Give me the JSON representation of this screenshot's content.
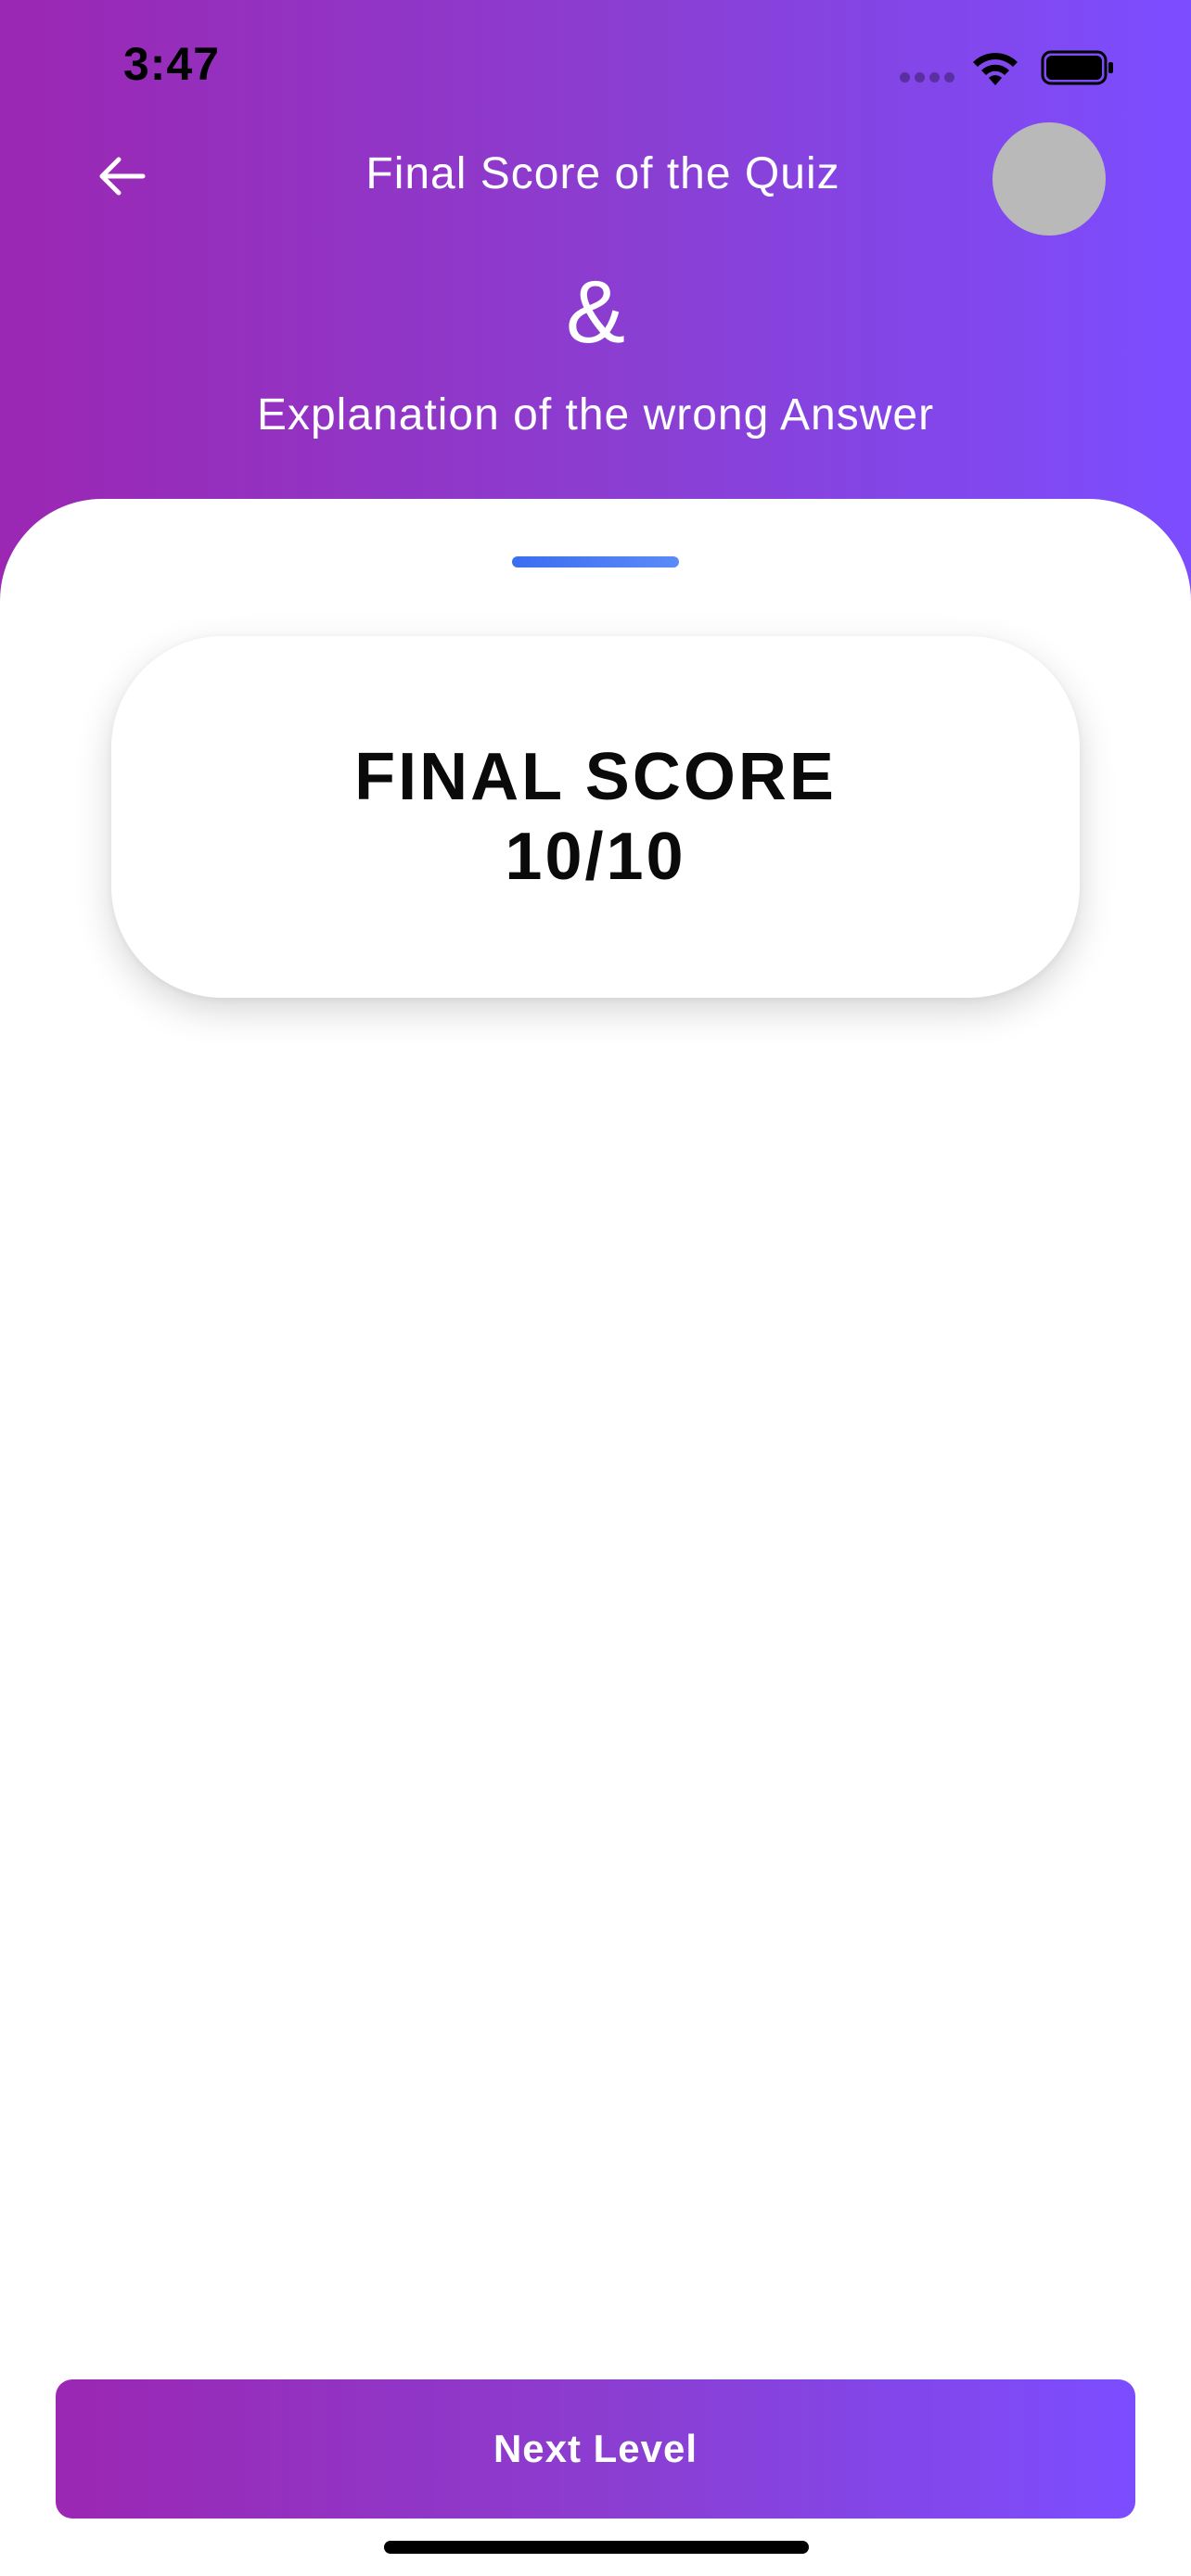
{
  "status_bar": {
    "time": "3:47",
    "icons": [
      "signal-icon",
      "wifi-icon",
      "battery-icon"
    ]
  },
  "header": {
    "back_icon": "arrow-left-icon",
    "title": "Final Score of the Quiz",
    "ampersand": "&",
    "subtitle": "Explanation of the wrong Answer"
  },
  "score_card": {
    "label": "FINAL SCORE",
    "value": "10/10"
  },
  "footer": {
    "next_label": "Next Level"
  },
  "colors": {
    "gradient_start": "#9b27b3",
    "gradient_end": "#7c4dff",
    "handle": "#3b6df0",
    "avatar": "#b9b9b9",
    "text_dark": "#0a0a0a",
    "text_light": "#ffffff"
  }
}
